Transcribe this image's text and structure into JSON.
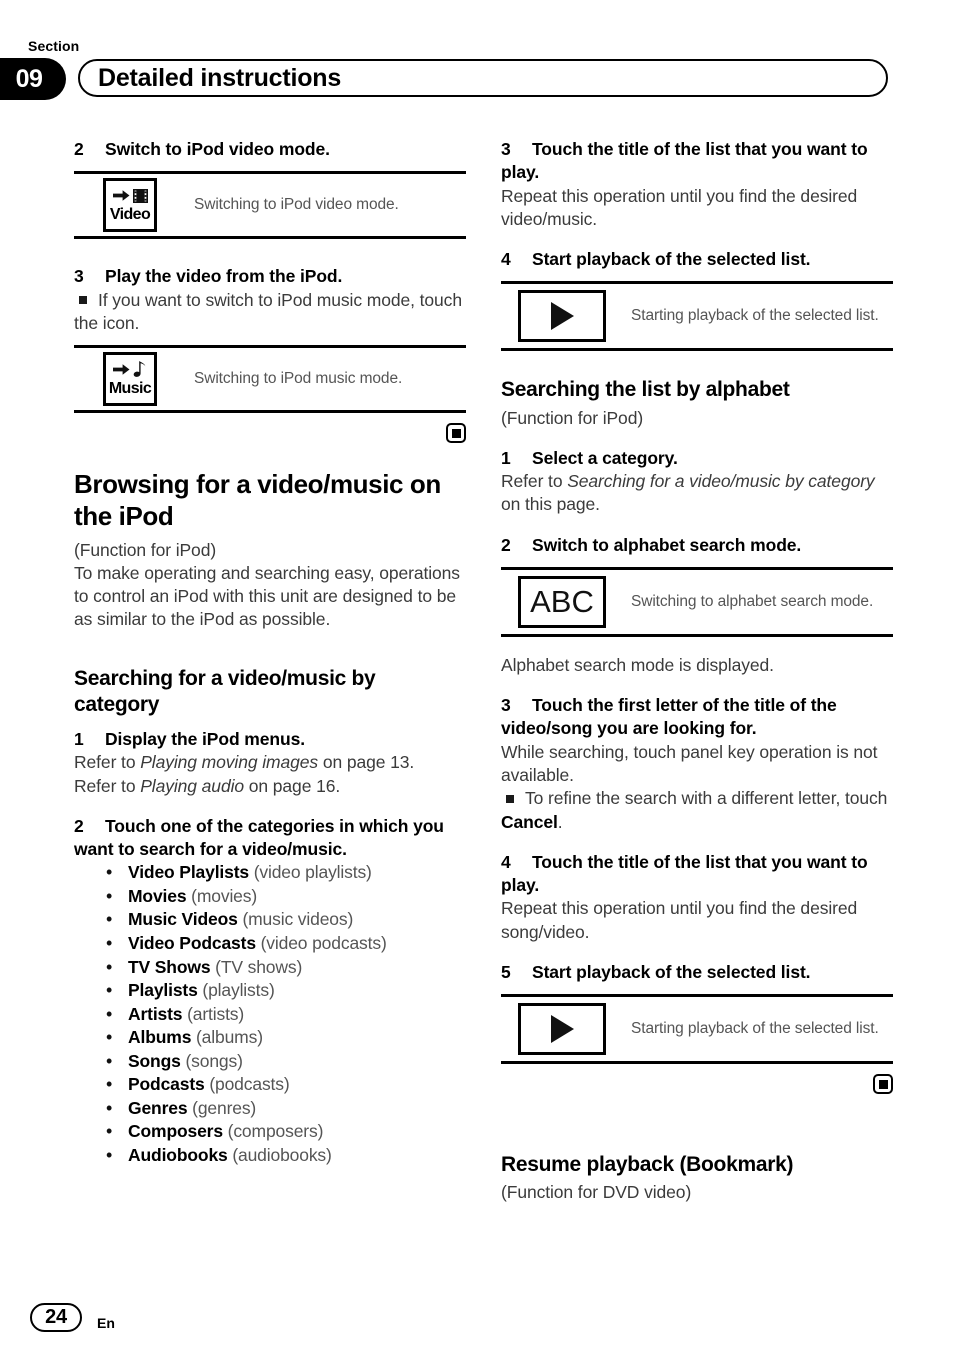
{
  "header": {
    "section_label": "Section",
    "section_number": "09",
    "title": "Detailed instructions"
  },
  "left_column": {
    "step2": {
      "num": "2",
      "text": "Switch to iPod video mode."
    },
    "video_key": {
      "arrow_icon": "right-arrow-icon",
      "film_icon": "film-strip-icon",
      "label": "Video",
      "description": "Switching to iPod video mode."
    },
    "step3": {
      "num": "3",
      "text": "Play the video from the iPod.",
      "note": "If you want to switch to iPod music mode, touch the icon."
    },
    "music_key": {
      "arrow_icon": "right-arrow-icon",
      "note_icon": "music-note-icon",
      "label": "Music",
      "description": "Switching to iPod music mode."
    },
    "end_marker": "end-of-section-marker",
    "heading": "Browsing for a video/music on the iPod",
    "function_note": "(Function for iPod)",
    "intro": "To make operating and searching easy, operations to control an iPod with this unit are designed to be as similar to the iPod as possible.",
    "subheading": "Searching for a video/music by category",
    "cat_step1": {
      "num": "1",
      "text": "Display the iPod menus.",
      "refer1_prefix": "Refer to ",
      "refer1_italic": "Playing moving images",
      "refer1_suffix": " on page 13.",
      "refer2_prefix": "Refer to ",
      "refer2_italic": "Playing audio",
      "refer2_suffix": " on page 16."
    },
    "cat_step2": {
      "num": "2",
      "text": "Touch one of the categories in which you want to search for a video/music."
    },
    "categories": [
      {
        "name": "Video Playlists",
        "desc": "(video playlists)"
      },
      {
        "name": "Movies",
        "desc": "(movies)"
      },
      {
        "name": "Music Videos",
        "desc": "(music videos)"
      },
      {
        "name": "Video Podcasts",
        "desc": "(video podcasts)"
      },
      {
        "name": "TV Shows",
        "desc": "(TV shows)"
      },
      {
        "name": "Playlists",
        "desc": "(playlists)"
      },
      {
        "name": "Artists",
        "desc": "(artists)"
      },
      {
        "name": "Albums",
        "desc": "(albums)"
      },
      {
        "name": "Songs",
        "desc": "(songs)"
      },
      {
        "name": "Podcasts",
        "desc": "(podcasts)"
      },
      {
        "name": "Genres",
        "desc": "(genres)"
      },
      {
        "name": "Composers",
        "desc": "(composers)"
      },
      {
        "name": "Audiobooks",
        "desc": "(audiobooks)"
      }
    ]
  },
  "right_column": {
    "cat_step3": {
      "num": "3",
      "text": "Touch the title of the list that you want to play.",
      "body": "Repeat this operation until you find the desired video/music."
    },
    "cat_step4": {
      "num": "4",
      "text": "Start playback of the selected list."
    },
    "play_key_1": {
      "icon": "play-triangle-icon",
      "description": "Starting playback of the selected list."
    },
    "heading": "Searching the list by alphabet",
    "function_note": "(Function for iPod)",
    "alpha_step1": {
      "num": "1",
      "text": "Select a category.",
      "refer_prefix": "Refer to ",
      "refer_italic": "Searching for a video/music by category",
      "refer_suffix": " on this page."
    },
    "alpha_step2": {
      "num": "2",
      "text": "Switch to alphabet search mode."
    },
    "abc_key": {
      "label": "ABC",
      "description": "Switching to alphabet search mode."
    },
    "alpha_after_key": "Alphabet search mode is displayed.",
    "alpha_step3": {
      "num": "3",
      "text": "Touch the first letter of the title of the video/song you are looking for.",
      "body": "While searching, touch panel key operation is not available.",
      "note_prefix": "To refine the search with a different letter, touch ",
      "note_bold": "Cancel",
      "note_suffix": "."
    },
    "alpha_step4": {
      "num": "4",
      "text": "Touch the title of the list that you want to play.",
      "body": "Repeat this operation until you find the desired song/video."
    },
    "alpha_step5": {
      "num": "5",
      "text": "Start playback of the selected list."
    },
    "play_key_2": {
      "icon": "play-triangle-icon",
      "description": "Starting playback of the selected list."
    },
    "end_marker": "end-of-section-marker",
    "resume_heading": "Resume playback (Bookmark)",
    "resume_note": "(Function for DVD video)"
  },
  "footer": {
    "page_number": "24",
    "language": "En"
  }
}
